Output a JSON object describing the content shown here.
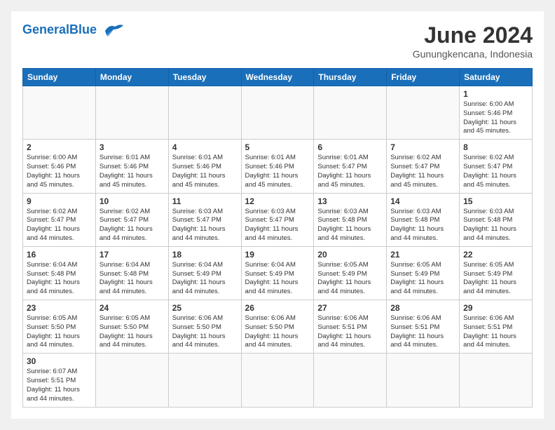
{
  "header": {
    "logo_general": "General",
    "logo_blue": "Blue",
    "month_title": "June 2024",
    "subtitle": "Gunungkencana, Indonesia"
  },
  "days_of_week": [
    "Sunday",
    "Monday",
    "Tuesday",
    "Wednesday",
    "Thursday",
    "Friday",
    "Saturday"
  ],
  "weeks": [
    [
      {
        "day": "",
        "info": ""
      },
      {
        "day": "",
        "info": ""
      },
      {
        "day": "",
        "info": ""
      },
      {
        "day": "",
        "info": ""
      },
      {
        "day": "",
        "info": ""
      },
      {
        "day": "",
        "info": ""
      },
      {
        "day": "1",
        "info": "Sunrise: 6:00 AM\nSunset: 5:46 PM\nDaylight: 11 hours\nand 45 minutes."
      }
    ],
    [
      {
        "day": "2",
        "info": "Sunrise: 6:00 AM\nSunset: 5:46 PM\nDaylight: 11 hours\nand 45 minutes."
      },
      {
        "day": "3",
        "info": "Sunrise: 6:01 AM\nSunset: 5:46 PM\nDaylight: 11 hours\nand 45 minutes."
      },
      {
        "day": "4",
        "info": "Sunrise: 6:01 AM\nSunset: 5:46 PM\nDaylight: 11 hours\nand 45 minutes."
      },
      {
        "day": "5",
        "info": "Sunrise: 6:01 AM\nSunset: 5:46 PM\nDaylight: 11 hours\nand 45 minutes."
      },
      {
        "day": "6",
        "info": "Sunrise: 6:01 AM\nSunset: 5:47 PM\nDaylight: 11 hours\nand 45 minutes."
      },
      {
        "day": "7",
        "info": "Sunrise: 6:02 AM\nSunset: 5:47 PM\nDaylight: 11 hours\nand 45 minutes."
      },
      {
        "day": "8",
        "info": "Sunrise: 6:02 AM\nSunset: 5:47 PM\nDaylight: 11 hours\nand 45 minutes."
      }
    ],
    [
      {
        "day": "9",
        "info": "Sunrise: 6:02 AM\nSunset: 5:47 PM\nDaylight: 11 hours\nand 44 minutes."
      },
      {
        "day": "10",
        "info": "Sunrise: 6:02 AM\nSunset: 5:47 PM\nDaylight: 11 hours\nand 44 minutes."
      },
      {
        "day": "11",
        "info": "Sunrise: 6:03 AM\nSunset: 5:47 PM\nDaylight: 11 hours\nand 44 minutes."
      },
      {
        "day": "12",
        "info": "Sunrise: 6:03 AM\nSunset: 5:47 PM\nDaylight: 11 hours\nand 44 minutes."
      },
      {
        "day": "13",
        "info": "Sunrise: 6:03 AM\nSunset: 5:48 PM\nDaylight: 11 hours\nand 44 minutes."
      },
      {
        "day": "14",
        "info": "Sunrise: 6:03 AM\nSunset: 5:48 PM\nDaylight: 11 hours\nand 44 minutes."
      },
      {
        "day": "15",
        "info": "Sunrise: 6:03 AM\nSunset: 5:48 PM\nDaylight: 11 hours\nand 44 minutes."
      }
    ],
    [
      {
        "day": "16",
        "info": "Sunrise: 6:04 AM\nSunset: 5:48 PM\nDaylight: 11 hours\nand 44 minutes."
      },
      {
        "day": "17",
        "info": "Sunrise: 6:04 AM\nSunset: 5:48 PM\nDaylight: 11 hours\nand 44 minutes."
      },
      {
        "day": "18",
        "info": "Sunrise: 6:04 AM\nSunset: 5:49 PM\nDaylight: 11 hours\nand 44 minutes."
      },
      {
        "day": "19",
        "info": "Sunrise: 6:04 AM\nSunset: 5:49 PM\nDaylight: 11 hours\nand 44 minutes."
      },
      {
        "day": "20",
        "info": "Sunrise: 6:05 AM\nSunset: 5:49 PM\nDaylight: 11 hours\nand 44 minutes."
      },
      {
        "day": "21",
        "info": "Sunrise: 6:05 AM\nSunset: 5:49 PM\nDaylight: 11 hours\nand 44 minutes."
      },
      {
        "day": "22",
        "info": "Sunrise: 6:05 AM\nSunset: 5:49 PM\nDaylight: 11 hours\nand 44 minutes."
      }
    ],
    [
      {
        "day": "23",
        "info": "Sunrise: 6:05 AM\nSunset: 5:50 PM\nDaylight: 11 hours\nand 44 minutes."
      },
      {
        "day": "24",
        "info": "Sunrise: 6:05 AM\nSunset: 5:50 PM\nDaylight: 11 hours\nand 44 minutes."
      },
      {
        "day": "25",
        "info": "Sunrise: 6:06 AM\nSunset: 5:50 PM\nDaylight: 11 hours\nand 44 minutes."
      },
      {
        "day": "26",
        "info": "Sunrise: 6:06 AM\nSunset: 5:50 PM\nDaylight: 11 hours\nand 44 minutes."
      },
      {
        "day": "27",
        "info": "Sunrise: 6:06 AM\nSunset: 5:51 PM\nDaylight: 11 hours\nand 44 minutes."
      },
      {
        "day": "28",
        "info": "Sunrise: 6:06 AM\nSunset: 5:51 PM\nDaylight: 11 hours\nand 44 minutes."
      },
      {
        "day": "29",
        "info": "Sunrise: 6:06 AM\nSunset: 5:51 PM\nDaylight: 11 hours\nand 44 minutes."
      }
    ],
    [
      {
        "day": "30",
        "info": "Sunrise: 6:07 AM\nSunset: 5:51 PM\nDaylight: 11 hours\nand 44 minutes."
      },
      {
        "day": "",
        "info": ""
      },
      {
        "day": "",
        "info": ""
      },
      {
        "day": "",
        "info": ""
      },
      {
        "day": "",
        "info": ""
      },
      {
        "day": "",
        "info": ""
      },
      {
        "day": "",
        "info": ""
      }
    ]
  ]
}
